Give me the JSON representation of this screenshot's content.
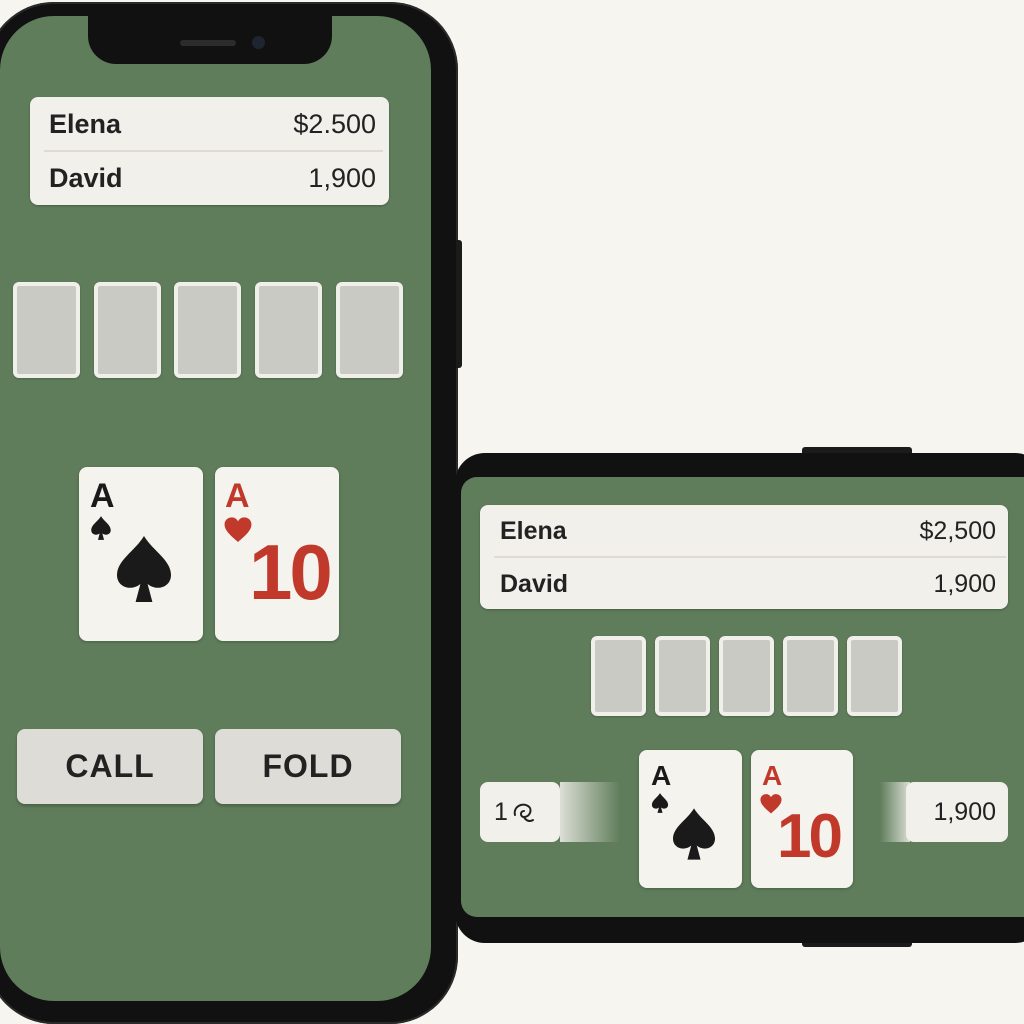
{
  "portrait": {
    "players": [
      {
        "name": "Elena",
        "chips": "$2.500"
      },
      {
        "name": "David",
        "chips": "1,900"
      }
    ],
    "community_cards": [
      "face-down",
      "face-down",
      "face-down",
      "face-down",
      "face-down"
    ],
    "hand": [
      {
        "rank": "A",
        "suit": "spade",
        "color": "#1a1a1a"
      },
      {
        "rank": "A",
        "suit": "heart",
        "center": "10",
        "color": "#c0392b"
      }
    ],
    "buttons": {
      "call": "CALL",
      "fold": "FOLD"
    }
  },
  "landscape": {
    "players": [
      {
        "name": "Elena",
        "chips": "$2,500"
      },
      {
        "name": "David",
        "chips": "1,900"
      }
    ],
    "community_cards": [
      "face-down",
      "face-down",
      "face-down",
      "face-down",
      "face-down"
    ],
    "hand": [
      {
        "rank": "A",
        "suit": "spade",
        "color": "#1a1a1a"
      },
      {
        "rank": "A",
        "suit": "heart",
        "center": "10",
        "color": "#c0392b"
      }
    ],
    "left_chip_value": "1",
    "left_chip_icon": "chip-icon",
    "right_chip_value": "1,900"
  },
  "colors": {
    "felt": "#5f7d5b",
    "panel": "#f2f0ea",
    "card_back": "#c9cac4",
    "red_suit": "#c0392b",
    "black_suit": "#1a1a1a"
  }
}
